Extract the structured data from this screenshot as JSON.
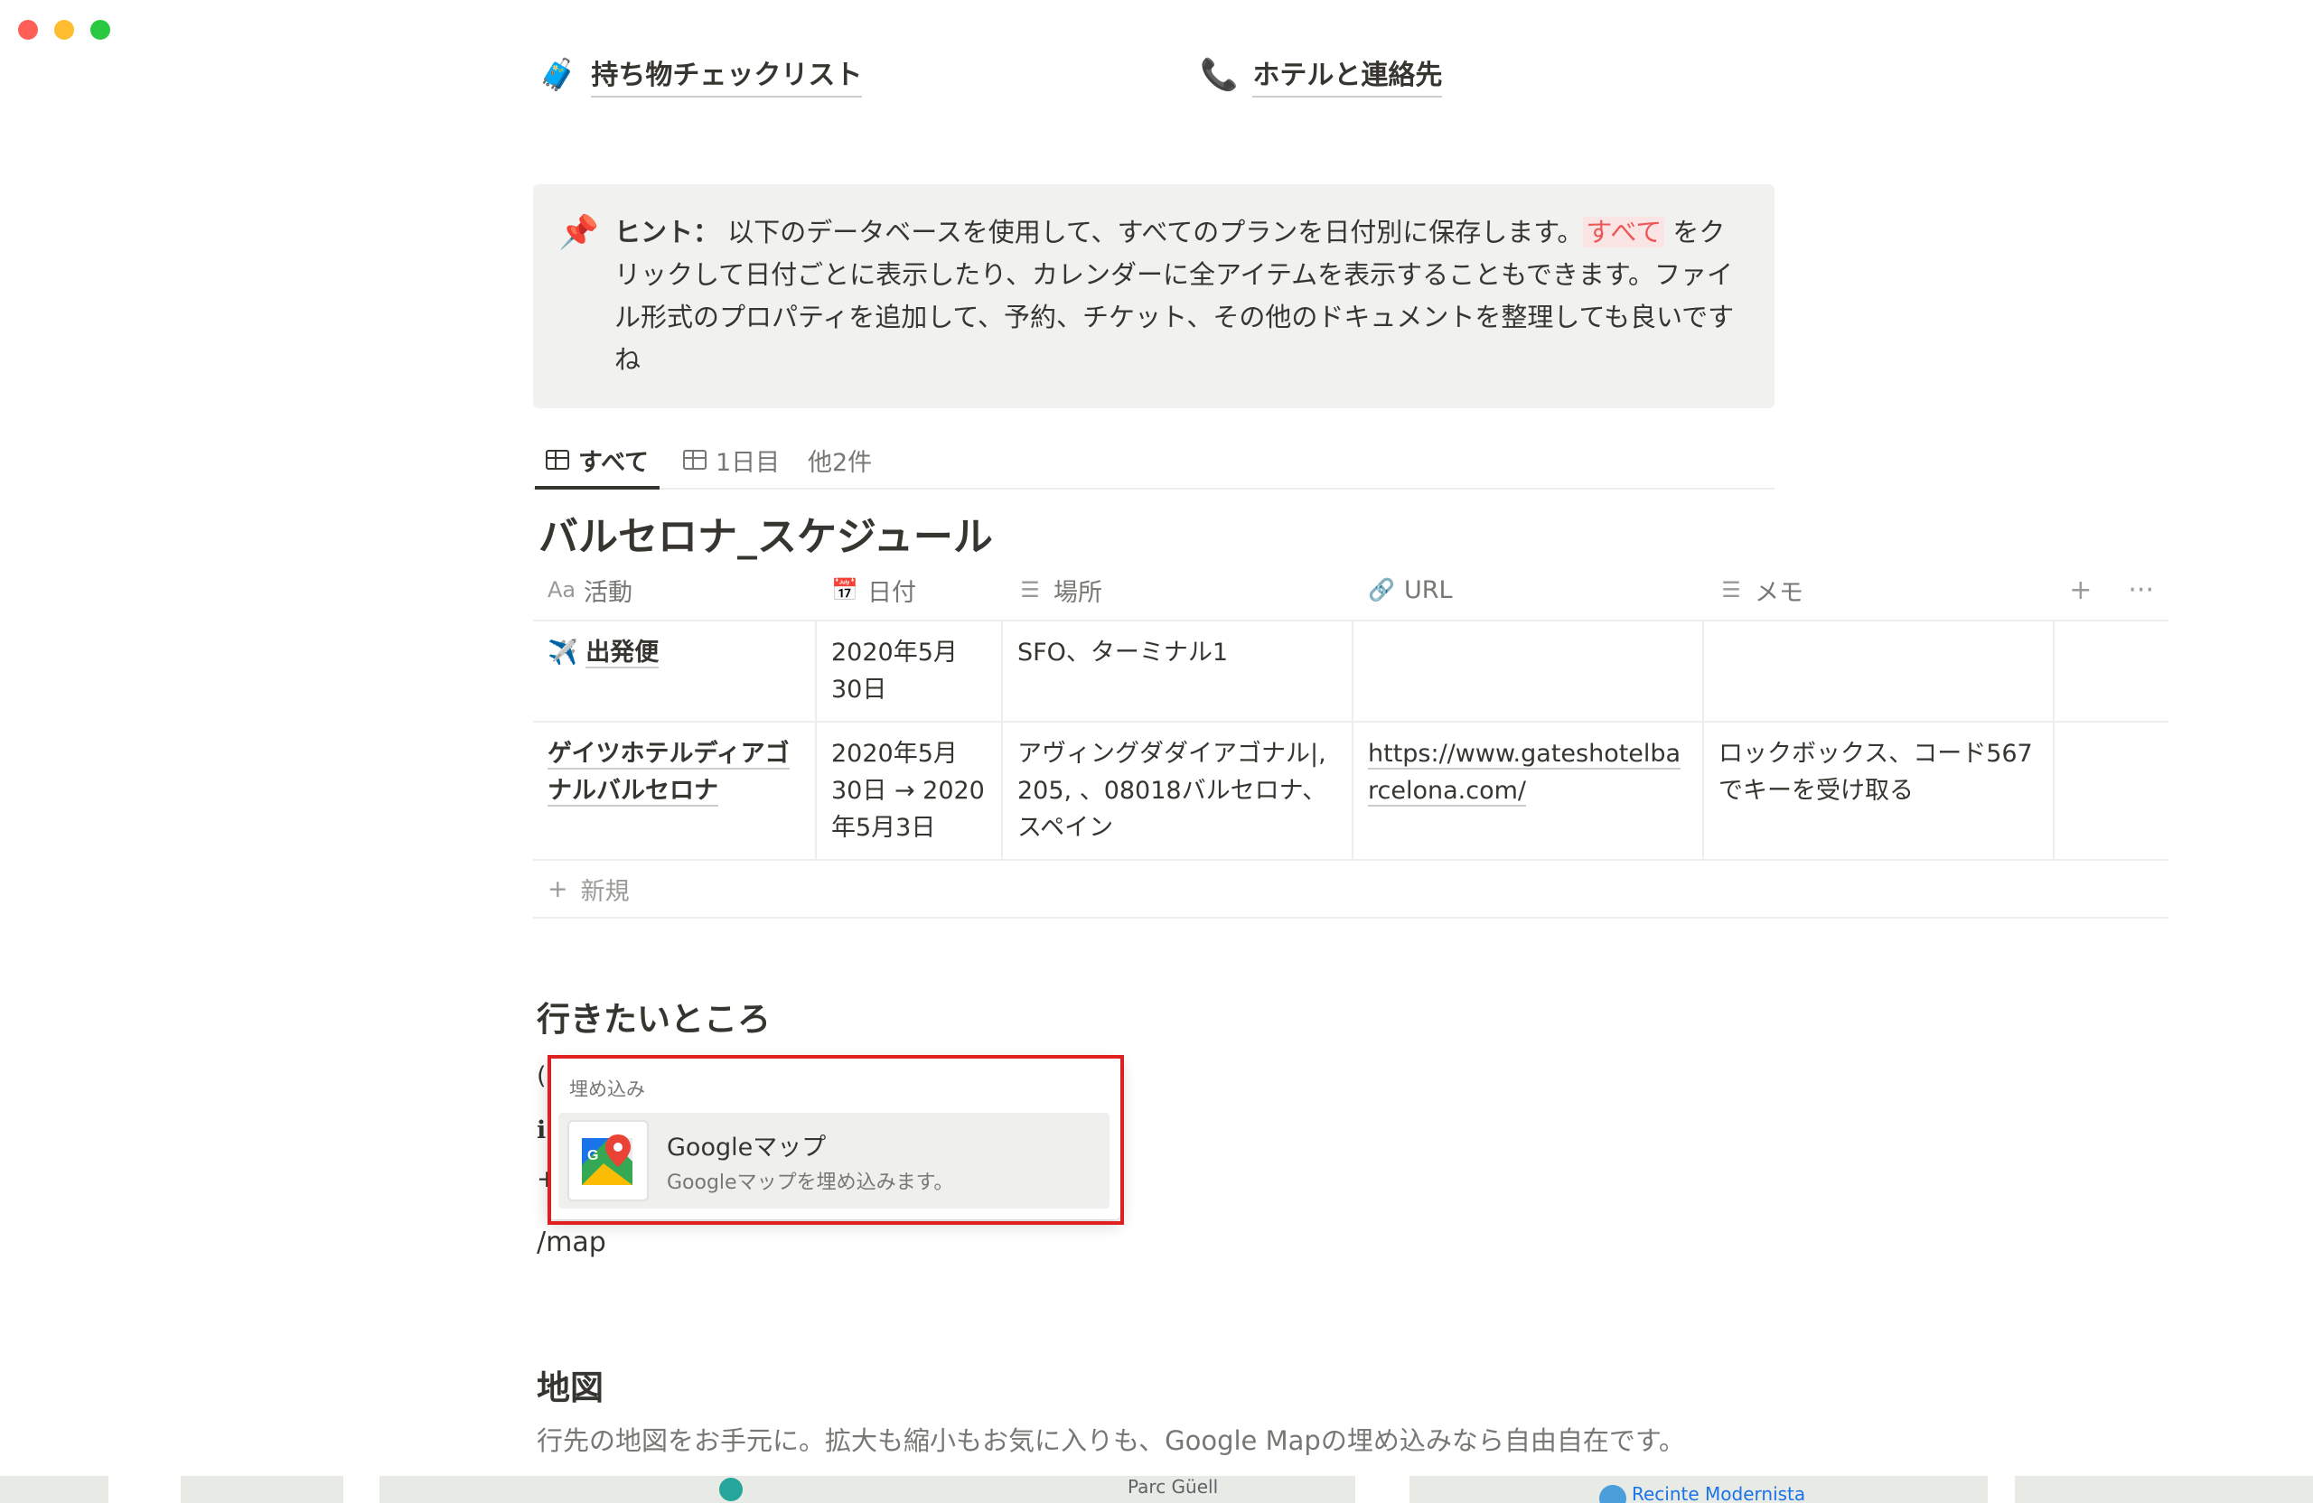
{
  "links": {
    "packing": {
      "icon": "luggage-icon",
      "label": "持ち物チェックリスト"
    },
    "hotel": {
      "icon": "phone-icon",
      "label": "ホテルと連絡先"
    }
  },
  "callout": {
    "icon": "pushpin-icon",
    "bold": "ヒント：",
    "text1": " 以下のデータベースを使用して、すべてのプランを日付別に保存します。",
    "highlight": "すべて",
    "text2": " をクリックして日付ごとに表示したり、カレンダーに全アイテムを表示することもできます。ファイル形式のプロパティを追加して、予約、チケット、その他のドキュメントを整理しても良いですね"
  },
  "tabs": [
    {
      "label": "すべて",
      "active": true
    },
    {
      "label": "1日目",
      "active": false
    },
    {
      "label": "他2件",
      "active": false
    }
  ],
  "database": {
    "title": "バルセロナ_スケジュール",
    "columns": [
      "活動",
      "日付",
      "場所",
      "URL",
      "メモ"
    ],
    "column_prefix": "Aa",
    "rows": [
      {
        "icon": "airplane-icon",
        "name": "出発便",
        "date": "2020年5月30日",
        "place": "SFO、ターミナル1",
        "url": "",
        "memo": ""
      },
      {
        "icon": "",
        "name": "ゲイツホテルディアゴナルバルセロナ",
        "date": "2020年5月30日 → 2020年5月3日",
        "place": "アヴィングダダイアゴナル|, 205, 、08018バルセロナ、スペイン",
        "url": "https://www.gateshotelbarcelona.com/",
        "memo": "ロックボックス、コード567でキーを受け取る"
      }
    ],
    "new_label": "新規",
    "add_icon": "+",
    "more_icon": "···"
  },
  "section_wanted": "行きたいところ",
  "menu": {
    "label": "埋め込み",
    "item_title": "Googleマップ",
    "item_desc": "Googleマップを埋め込みます。"
  },
  "slash_command": "/map",
  "section_map": "地図",
  "map_description": "行先の地図をお手元に。拡大も縮小もお気に入りも、Google Mapの埋め込みなら自由自在です。",
  "map_labels": [
    "Parc Güell",
    "Recinte Modernista"
  ],
  "colors": {
    "text": "#37352f",
    "muted": "#787774",
    "callout_bg": "#f1f1ef",
    "highlight_red": "#e02020",
    "link_red": "#eb5757"
  }
}
